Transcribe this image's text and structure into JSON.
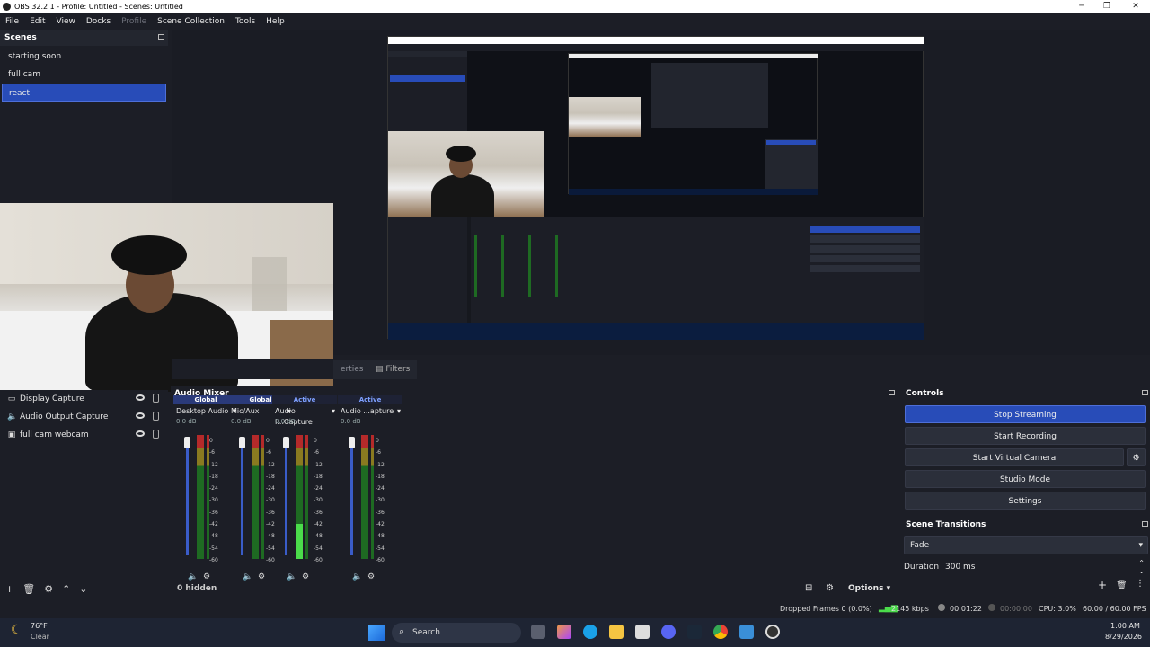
{
  "window": {
    "title": "OBS 32.2.1 - Profile: Untitled - Scenes: Untitled",
    "minimize": "─",
    "maximize": "❐",
    "close": "✕"
  },
  "menu": [
    "File",
    "Edit",
    "View",
    "Docks",
    "Profile",
    "Scene Collection",
    "Tools",
    "Help"
  ],
  "scenes": {
    "title": "Scenes",
    "items": [
      "starting soon",
      "full cam",
      "react"
    ],
    "selected": "react"
  },
  "tabs": {
    "properties": "erties",
    "filters": "Filters"
  },
  "sources": {
    "items": [
      {
        "label": "Display Capture",
        "icon": "monitor-icon"
      },
      {
        "label": "Audio Output Capture",
        "icon": "speaker-icon"
      },
      {
        "label": "full cam webcam",
        "icon": "camera-icon"
      }
    ],
    "toolbar": [
      "+",
      "🗑",
      "⚙",
      "⌃",
      "⌄"
    ]
  },
  "mixer": {
    "title": "Audio Mixer",
    "channels": [
      {
        "tag": "Global",
        "name": "Desktop Audio",
        "db": "0.0 dB",
        "level": 0
      },
      {
        "tag": "Global",
        "name": "Mic/Aux",
        "db": "0.0 dB",
        "level": 0
      },
      {
        "tag": "Active",
        "name": "Audio I...Capture",
        "db": "0.0 dB",
        "level": 0.28
      },
      {
        "tag": "Active",
        "name": "Audio ...apture",
        "db": "0.0 dB",
        "level": 0
      }
    ],
    "scale": [
      "0",
      "-6",
      "-12",
      "-18",
      "-24",
      "-30",
      "-36",
      "-42",
      "-48",
      "-54",
      "-60"
    ],
    "hidden": "0 hidden",
    "options": "Options"
  },
  "controls": {
    "title": "Controls",
    "stop_streaming": "Stop Streaming",
    "start_recording": "Start Recording",
    "start_virtual_camera": "Start Virtual Camera",
    "studio_mode": "Studio Mode",
    "settings": "Settings"
  },
  "transitions": {
    "title": "Scene Transitions",
    "type": "Fade",
    "duration_label": "Duration",
    "duration_value": "300 ms"
  },
  "status": {
    "dropped": "Dropped Frames 0 (0.0%)",
    "bitrate": "2145 kbps",
    "stream_time": "00:01:22",
    "rec_time": "00:00:00",
    "cpu": "CPU: 3.0%",
    "fps": "60.00 / 60.00 FPS"
  },
  "taskbar": {
    "weather_temp": "76°F",
    "weather_desc": "Clear",
    "search": "Search",
    "time": "1:00 AM",
    "date": "8/29/2026"
  },
  "colors": {
    "accent": "#284cb8",
    "bg": "#1c1e26"
  }
}
